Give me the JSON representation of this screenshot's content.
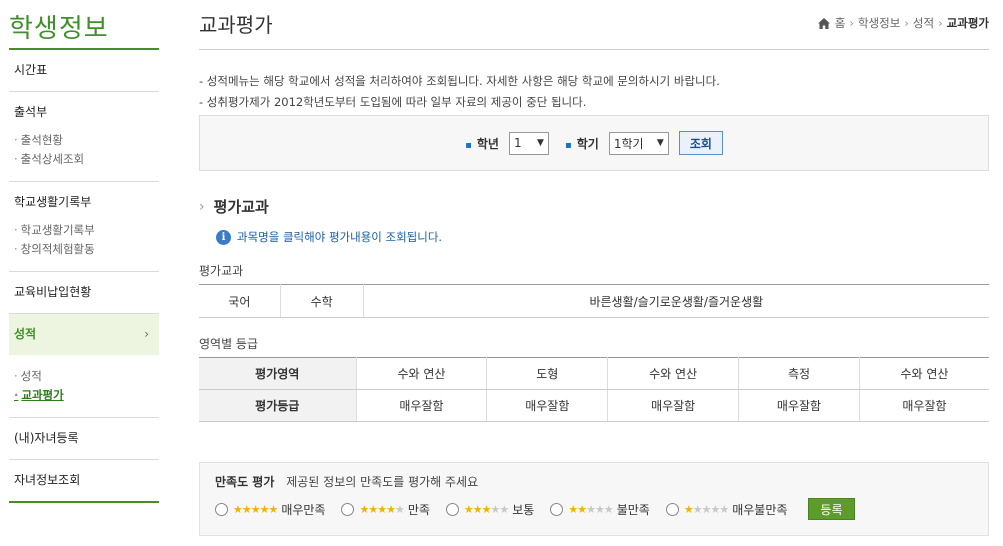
{
  "sidebar": {
    "title": "학생정보",
    "items": [
      {
        "label": "시간표",
        "sub": []
      },
      {
        "label": "출석부",
        "sub": [
          "출석현황",
          "출석상세조회"
        ]
      },
      {
        "label": "학교생활기록부",
        "sub": [
          "학교생활기록부",
          "창의적체험활동"
        ]
      },
      {
        "label": "교육비납입현황",
        "sub": []
      },
      {
        "label": "성적",
        "sub": [
          "성적",
          "교과평가"
        ]
      },
      {
        "label": "(내)자녀등록",
        "sub": []
      },
      {
        "label": "자녀정보조회",
        "sub": []
      }
    ]
  },
  "header": {
    "title": "교과평가",
    "breadcrumb": [
      "홈",
      "학생정보",
      "성적",
      "교과평가"
    ]
  },
  "notes": [
    "- 성적메뉴는 해당 학교에서 성적을 처리하여야 조회됩니다. 자세한 사항은 해당 학교에 문의하시기 바랍니다.",
    "- 성취평가제가 2012학년도부터 도입됨에 따라 일부 자료의 제공이 중단 됩니다."
  ],
  "search": {
    "grade_label": "학년",
    "grade_value": "1",
    "semester_label": "학기",
    "semester_value": "1학기",
    "button": "조회"
  },
  "section": {
    "title": "평가교과",
    "info": "과목명을 클릭해야 평가내용이 조회됩니다."
  },
  "subjects": {
    "caption": "평가교과",
    "items": [
      "국어",
      "수학",
      "바른생활/슬기로운생활/즐거운생활"
    ]
  },
  "areas": {
    "caption": "영역별 등급",
    "row_area_label": "평가영역",
    "row_grade_label": "평가등급",
    "area_values": [
      "수와 연산",
      "도형",
      "수와 연산",
      "측정",
      "수와 연산"
    ],
    "grade_values": [
      "매우잘함",
      "매우잘함",
      "매우잘함",
      "매우잘함",
      "매우잘함"
    ]
  },
  "satisfaction": {
    "title": "만족도 평가",
    "prompt": "제공된 정보의 만족도를 평가해 주세요",
    "options": [
      {
        "label": "매우만족",
        "stars": 5
      },
      {
        "label": "만족",
        "stars": 4
      },
      {
        "label": "보통",
        "stars": 3
      },
      {
        "label": "불만족",
        "stars": 2
      },
      {
        "label": "매우불만족",
        "stars": 1
      }
    ],
    "submit": "등록"
  },
  "colors": {
    "accent": "#3f8f2a",
    "link": "#1a5ea8",
    "star": "#f0b400"
  }
}
